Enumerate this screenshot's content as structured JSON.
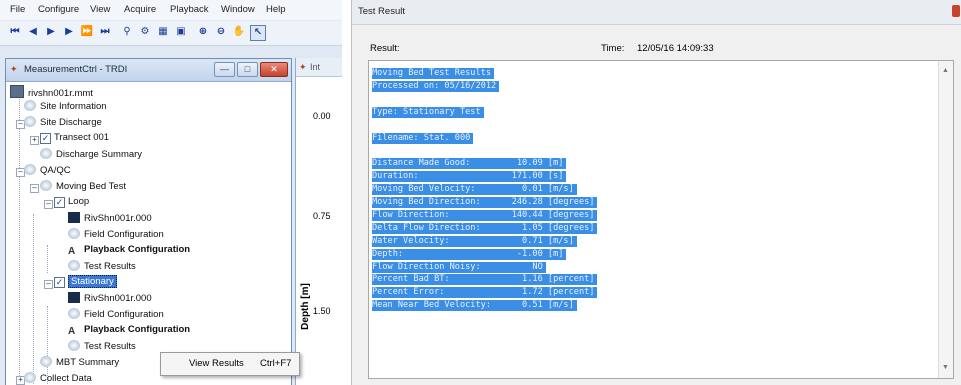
{
  "menu": [
    "File",
    "Configure",
    "View",
    "Acquire",
    "Playback",
    "Window",
    "Help"
  ],
  "measurement_window": {
    "title": "MeasurementCtrl - TRDI",
    "tree": {
      "root": "rivshn001r.mmt",
      "site_information": "Site Information",
      "site_discharge": "Site Discharge",
      "transect": "Transect 001",
      "discharge_summary": "Discharge Summary",
      "qa_qc": "QA/QC",
      "moving_bed_test": "Moving Bed Test",
      "loop": "Loop",
      "loop_file": "RivShn001r.000",
      "loop_field_config": "Field Configuration",
      "loop_playback_config": "Playback Configuration",
      "loop_test_results": "Test Results",
      "stationary": "Stationary",
      "stat_file": "RivShn001r.000",
      "stat_field_config": "Field Configuration",
      "stat_playback_config": "Playback Configuration",
      "stat_test_results": "Test Results",
      "mbt_summary": "MBT Summary",
      "collect_data": "Collect Data"
    }
  },
  "side_panel": {
    "tab_label": "Int",
    "values": [
      "0.00",
      "0.75",
      "1.50"
    ],
    "axis_label": "Depth [m]"
  },
  "context_menu": {
    "label": "View Results",
    "shortcut": "Ctrl+F7"
  },
  "test_result": {
    "window_title": "Test Result",
    "result_label": "Result:",
    "time_label": "Time:",
    "time_value": "12/05/16 14:09:33",
    "lines": [
      "Moving Bed Test Results",
      "Processed on: 05/16/2012",
      "",
      "Type: Stationary Test",
      "",
      "Filename: Stat. 000",
      "",
      "Distance Made Good:         10.09 [m]",
      "Duration:                  171.00 [s]",
      "Moving Bed Velocity:         0.01 [m/s]",
      "Moving Bed Direction:      246.28 [degrees]",
      "Flow Direction:            140.44 [degrees]",
      "Delta Flow Direction:        1.05 [degrees]",
      "Water Velocity:              0.71 [m/s]",
      "Depth:                      -1.00 [m]",
      "Flow Direction Noisy:          NO",
      "Percent Bad BT:              1.16 [percent]",
      "Percent Error:               1.72 [percent]",
      "Mean Near Bed Velocity:      0.51 [m/s]"
    ]
  }
}
